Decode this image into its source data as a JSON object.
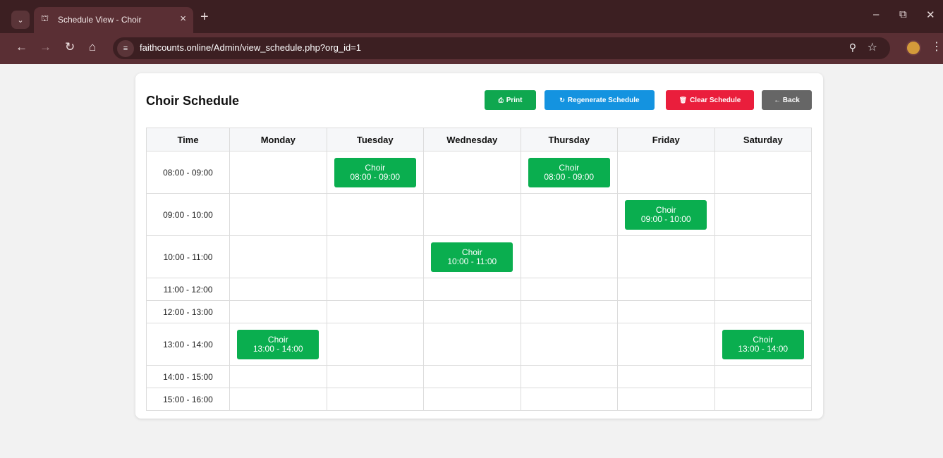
{
  "browser": {
    "tab_title": "Schedule View - Choir",
    "url": "faithcounts.online/Admin/view_schedule.php?org_id=1"
  },
  "page": {
    "title": "Choir Schedule",
    "buttons": {
      "print": "Print",
      "regenerate": "Regenerate Schedule",
      "clear": "Clear Schedule",
      "back": "← Back"
    },
    "colors": {
      "print": "#0fa74f",
      "regenerate": "#1493e0",
      "clear": "#ea1e3c",
      "back": "#666666",
      "event": "#0aae4f"
    }
  },
  "schedule": {
    "headers": [
      "Time",
      "Monday",
      "Tuesday",
      "Wednesday",
      "Thursday",
      "Friday",
      "Saturday"
    ],
    "rows": [
      {
        "time": "08:00 - 09:00",
        "events": [
          "",
          "Choir|08:00 - 09:00",
          "",
          "Choir|08:00 - 09:00",
          "",
          ""
        ]
      },
      {
        "time": "09:00 - 10:00",
        "events": [
          "",
          "",
          "",
          "",
          "Choir|09:00 - 10:00",
          ""
        ]
      },
      {
        "time": "10:00 - 11:00",
        "events": [
          "",
          "",
          "Choir|10:00 - 11:00",
          "",
          "",
          ""
        ]
      },
      {
        "time": "11:00 - 12:00",
        "events": [
          "",
          "",
          "",
          "",
          "",
          ""
        ]
      },
      {
        "time": "12:00 - 13:00",
        "events": [
          "",
          "",
          "",
          "",
          "",
          ""
        ]
      },
      {
        "time": "13:00 - 14:00",
        "events": [
          "Choir|13:00 - 14:00",
          "",
          "",
          "",
          "",
          "Choir|13:00 - 14:00"
        ]
      },
      {
        "time": "14:00 - 15:00",
        "events": [
          "",
          "",
          "",
          "",
          "",
          ""
        ]
      },
      {
        "time": "15:00 - 16:00",
        "events": [
          "",
          "",
          "",
          "",
          "",
          ""
        ]
      }
    ]
  }
}
